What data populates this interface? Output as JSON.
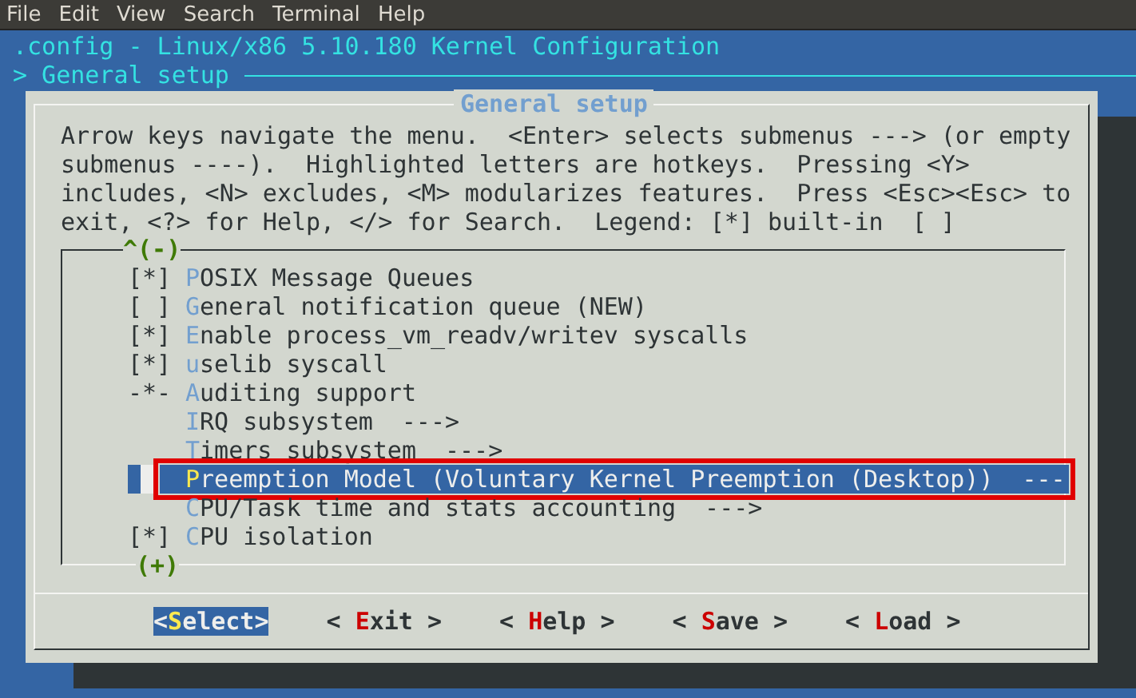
{
  "menubar": [
    "File",
    "Edit",
    "View",
    "Search",
    "Terminal",
    "Help"
  ],
  "title": ".config - Linux/x86 5.10.180 Kernel Configuration",
  "breadcrumb": "> General setup",
  "dialog": {
    "title": "General setup",
    "help_lines": [
      "Arrow keys navigate the menu.  <Enter> selects submenus ---> (or empty",
      "submenus ----).  Highlighted letters are hotkeys.  Pressing <Y>",
      "includes, <N> excludes, <M> modularizes features.  Press <Esc><Esc> to",
      "exit, <?> for Help, </> for Search.  Legend: [*] built-in  [ ]"
    ],
    "menu": {
      "scroll_up": "^(-)",
      "scroll_down": "(+)",
      "items": [
        {
          "prefix": "[*]",
          "label": "POSIX Message Queues",
          "selected": false,
          "annotated": false
        },
        {
          "prefix": "[ ]",
          "label": "General notification queue (NEW)",
          "selected": false,
          "annotated": false
        },
        {
          "prefix": "[*]",
          "label": "Enable process_vm_readv/writev syscalls",
          "selected": false,
          "annotated": false
        },
        {
          "prefix": "[*]",
          "label": "uselib syscall",
          "selected": false,
          "annotated": false
        },
        {
          "prefix": "-*-",
          "label": "Auditing support",
          "selected": false,
          "annotated": false
        },
        {
          "label": "IRQ subsystem",
          "suffix": "--->",
          "selected": false,
          "annotated": false
        },
        {
          "label": "Timers subsystem",
          "suffix": "--->",
          "selected": false,
          "annotated": false
        },
        {
          "label": "Preemption Model (Voluntary Kernel Preemption (Desktop))",
          "suffix": "---",
          "selected": true,
          "annotated": true
        },
        {
          "label": "CPU/Task time and stats accounting",
          "suffix": "--->",
          "selected": false,
          "annotated": false
        },
        {
          "prefix": "[*]",
          "label": "CPU isolation",
          "selected": false,
          "annotated": false
        }
      ]
    },
    "buttons": [
      {
        "label": "<Select>",
        "selected": true
      },
      {
        "label": "< Exit >",
        "selected": false
      },
      {
        "label": "< Help >",
        "selected": false
      },
      {
        "label": "< Save >",
        "selected": false
      },
      {
        "label": "< Load >",
        "selected": false
      }
    ]
  }
}
